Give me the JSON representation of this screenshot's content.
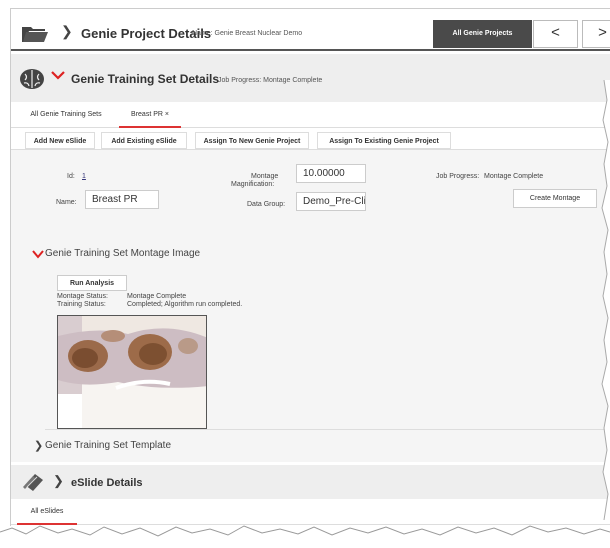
{
  "header": {
    "title": "Genie Project Details",
    "name_text": "Name: Genie Breast Nuclear Demo",
    "all_projects_label": "All Genie Projects",
    "prev_symbol": "<",
    "next_symbol": ">"
  },
  "training_set": {
    "title": "Genie Training Set Details",
    "job_progress_text": "Job Progress: Montage Complete"
  },
  "tabs": [
    {
      "label": "All Genie Training Sets"
    },
    {
      "label": "Breast PR ×"
    }
  ],
  "toolbar": {
    "add_new": "Add New eSlide",
    "add_existing": "Add Existing eSlide",
    "assign_new": "Assign To New Genie Project",
    "assign_existing": "Assign To Existing Genie Project"
  },
  "form": {
    "id_label": "Id:",
    "id_value": "1",
    "name_label": "Name:",
    "name_value": "Breast PR",
    "magnification_label_1": "Montage",
    "magnification_label_2": "Magnification:",
    "magnification_value": "10.00000",
    "data_group_label": "Data Group:",
    "data_group_value": "Demo_Pre-Clini",
    "job_progress_label": "Job Progress:",
    "job_progress_value": "Montage Complete",
    "create_montage": "Create Montage"
  },
  "montage": {
    "title": "Genie Training Set Montage Image",
    "run_analysis": "Run Analysis",
    "montage_status_label": "Montage Status:",
    "montage_status_value": "Montage Complete",
    "training_status_label": "Training Status:",
    "training_status_value": "Completed; Algorithm run completed."
  },
  "template": {
    "title": "Genie Training Set Template"
  },
  "eslide": {
    "title": "eSlide Details",
    "tab_label": "All eSlides"
  },
  "colors": {
    "accent_red": "#dd2222",
    "dark_button": "#4a4a4a"
  }
}
